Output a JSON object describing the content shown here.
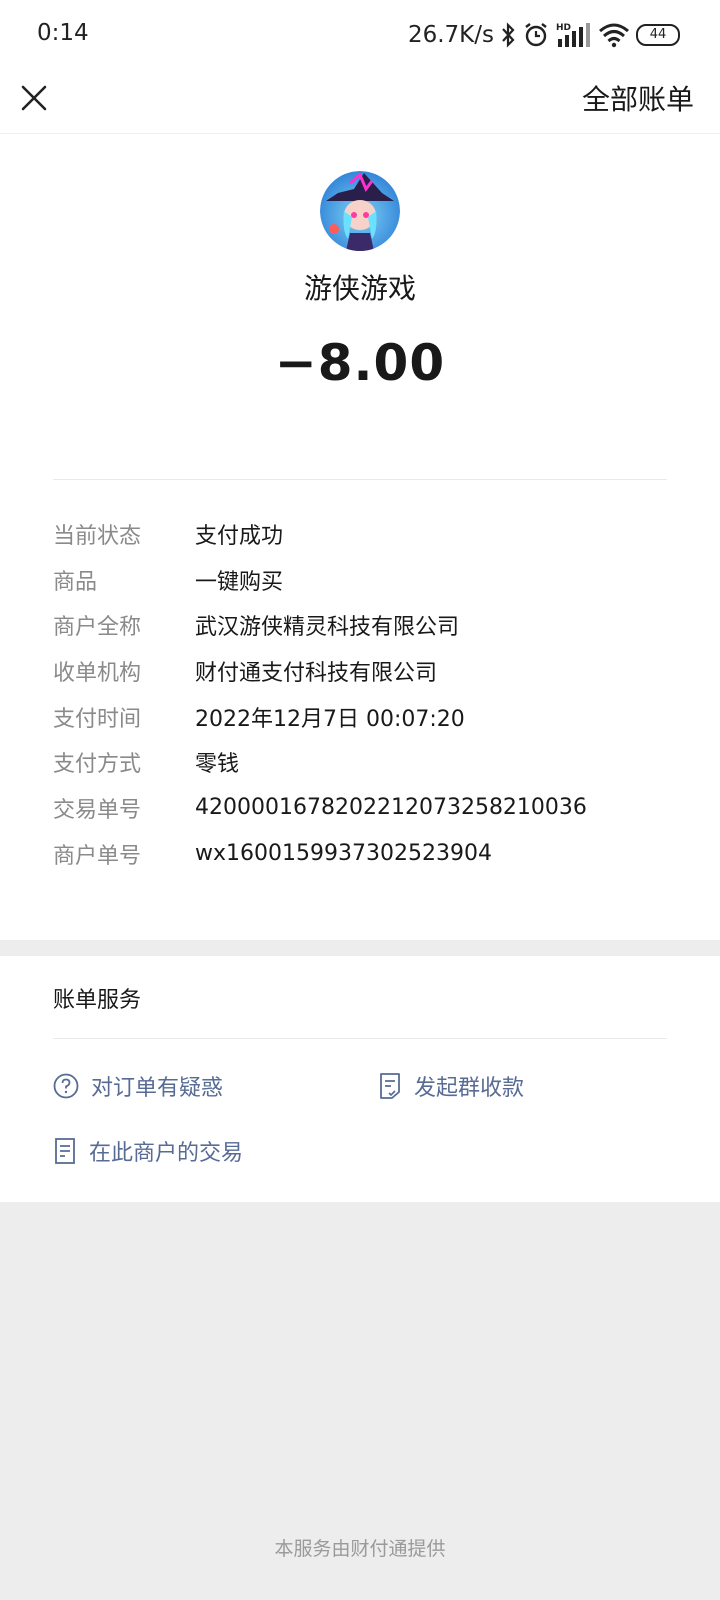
{
  "status_bar": {
    "time": "0:14",
    "net_speed": "26.7K/s",
    "battery": "44",
    "icons": [
      "bluetooth-icon",
      "alarm-icon",
      "hd-signal-icon",
      "wifi-icon",
      "battery-icon"
    ]
  },
  "topbar": {
    "close_icon": "close-icon",
    "all_bills_label": "全部账单"
  },
  "summary": {
    "merchant_name": "游侠游戏",
    "amount": "−8.00"
  },
  "details": [
    {
      "label": "当前状态",
      "value": "支付成功"
    },
    {
      "label": "商品",
      "value": "一键购买"
    },
    {
      "label": "商户全称",
      "value": "武汉游侠精灵科技有限公司"
    },
    {
      "label": "收单机构",
      "value": "财付通支付科技有限公司"
    },
    {
      "label": "支付时间",
      "value": "2022年12月7日 00:07:20"
    },
    {
      "label": "支付方式",
      "value": "零钱"
    },
    {
      "label": "交易单号",
      "value": "4200001678202212073258210036"
    },
    {
      "label": "商户单号",
      "value": "wx1600159937302523904"
    }
  ],
  "services": {
    "title": "账单服务",
    "links": [
      {
        "label": "对订单有疑惑",
        "icon": "question-circle-icon"
      },
      {
        "label": "发起群收款",
        "icon": "group-collect-icon"
      },
      {
        "label": "在此商户的交易",
        "icon": "document-icon"
      }
    ]
  },
  "footer": "本服务由财付通提供",
  "colors": {
    "link": "#576b95",
    "label_gray": "#8a8a8a",
    "background": "#ededed"
  }
}
